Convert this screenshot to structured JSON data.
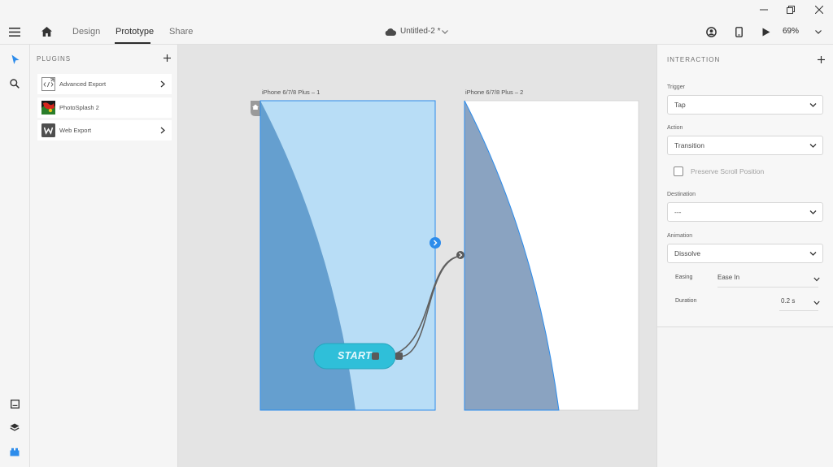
{
  "toolbar": {
    "tabs": [
      {
        "label": "Design"
      },
      {
        "label": "Prototype"
      },
      {
        "label": "Share"
      }
    ],
    "document_title": "Untitled-2 *",
    "zoom": "69%"
  },
  "plugins": {
    "heading": "PLUGINS",
    "items": [
      {
        "label": "Advanced Export"
      },
      {
        "label": "PhotoSplash 2"
      },
      {
        "label": "Web Export"
      }
    ]
  },
  "canvas": {
    "artboards": [
      {
        "title": "iPhone 6/7/8 Plus – 1"
      },
      {
        "title": "iPhone 6/7/8 Plus – 2"
      }
    ],
    "button_text": "START",
    "colors": {
      "selection": "#2d8ceb",
      "artboard1_bg": "#b8ddf6",
      "artboard1_shape": "#659fcf",
      "artboard2_bg": "#ffffff",
      "artboard2_shape": "#8aa3c1",
      "start_button": "#2fbfd9",
      "wire": "#606060"
    }
  },
  "interaction": {
    "heading": "INTERACTION",
    "trigger_label": "Trigger",
    "trigger_value": "Tap",
    "action_label": "Action",
    "action_value": "Transition",
    "preserve_label": "Preserve Scroll Position",
    "preserve_checked": false,
    "destination_label": "Destination",
    "destination_value": "---",
    "animation_label": "Animation",
    "animation_value": "Dissolve",
    "easing_label": "Easing",
    "easing_value": "Ease In",
    "duration_label": "Duration",
    "duration_value": "0.2 s"
  }
}
